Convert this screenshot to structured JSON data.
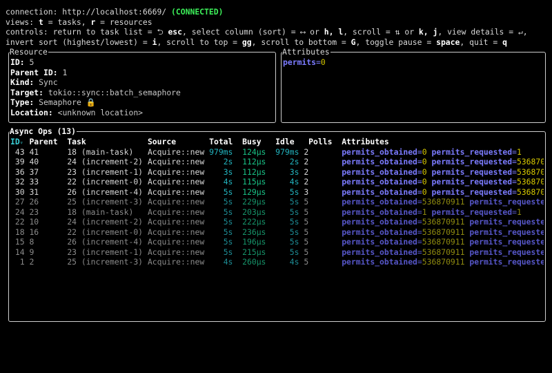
{
  "header": {
    "connection_label": "connection: http://localhost:6669/ ",
    "connection_status": "(CONNECTED)",
    "views": [
      {
        "text": "views: "
      },
      {
        "key": "t"
      },
      {
        "text": " = tasks, "
      },
      {
        "key": "r"
      },
      {
        "text": " = resources"
      }
    ],
    "controls1": [
      {
        "text": "controls: return to task list = ⮌ "
      },
      {
        "key": "esc"
      },
      {
        "text": ", select column (sort) = ⟷ or "
      },
      {
        "key": "h, l"
      },
      {
        "text": ", scroll = ⇅ or "
      },
      {
        "key": "k, j"
      },
      {
        "text": ", view details = ↵,"
      }
    ],
    "controls2": [
      {
        "text": "invert sort (highest/lowest) = "
      },
      {
        "key": "i"
      },
      {
        "text": ", scroll to top = "
      },
      {
        "key": "gg"
      },
      {
        "text": ", scroll to bottom = "
      },
      {
        "key": "G"
      },
      {
        "text": ", toggle pause = "
      },
      {
        "key": "space"
      },
      {
        "text": ", quit = "
      },
      {
        "key": "q"
      }
    ]
  },
  "resource": {
    "title": "Resource",
    "fields": [
      {
        "label": "ID:",
        "value": "5"
      },
      {
        "label": "Parent ID:",
        "value": "1"
      },
      {
        "label": "Kind:",
        "value": "Sync"
      },
      {
        "label": "Target:",
        "value": "tokio::sync::batch_semaphore"
      },
      {
        "label": "Type:",
        "value": "Semaphore 🔒"
      },
      {
        "label": "Location:",
        "value": "<unknown location>"
      }
    ]
  },
  "attributes": {
    "title": "Attributes",
    "items": [
      {
        "key": "permits",
        "value": "0"
      }
    ]
  },
  "async_ops": {
    "title": "Async Ops (13)",
    "sort_column": "ID",
    "sort_icon": "▿",
    "columns": [
      "ID",
      "Parent",
      "Task",
      "Source",
      "Total",
      "Busy",
      "Idle",
      "Polls",
      "Attributes"
    ],
    "rows": [
      {
        "id": "43",
        "parent": "41",
        "task": "18 (main-task)",
        "source": "Acquire::new",
        "total": "979ms",
        "busy": "124µs",
        "idle": "979ms",
        "polls": "2",
        "dim": false,
        "attrs": [
          {
            "key": "permits_obtained",
            "value": "0"
          },
          {
            "key": "permits_requested",
            "value": "1"
          }
        ]
      },
      {
        "id": "39",
        "parent": "40",
        "task": "24 (increment-2)",
        "source": "Acquire::new",
        "total": "2s",
        "busy": "112µs",
        "idle": "2s",
        "polls": "2",
        "dim": false,
        "attrs": [
          {
            "key": "permits_obtained",
            "value": "0"
          },
          {
            "key": "permits_requested",
            "value": "536870"
          }
        ]
      },
      {
        "id": "36",
        "parent": "37",
        "task": "23 (increment-1)",
        "source": "Acquire::new",
        "total": "3s",
        "busy": "112µs",
        "idle": "3s",
        "polls": "2",
        "dim": false,
        "attrs": [
          {
            "key": "permits_obtained",
            "value": "0"
          },
          {
            "key": "permits_requested",
            "value": "536870"
          }
        ]
      },
      {
        "id": "32",
        "parent": "33",
        "task": "22 (increment-0)",
        "source": "Acquire::new",
        "total": "4s",
        "busy": "115µs",
        "idle": "4s",
        "polls": "2",
        "dim": false,
        "attrs": [
          {
            "key": "permits_obtained",
            "value": "0"
          },
          {
            "key": "permits_requested",
            "value": "536870"
          }
        ]
      },
      {
        "id": "30",
        "parent": "31",
        "task": "26 (increment-4)",
        "source": "Acquire::new",
        "total": "5s",
        "busy": "129µs",
        "idle": "5s",
        "polls": "3",
        "dim": false,
        "attrs": [
          {
            "key": "permits_obtained",
            "value": "0"
          },
          {
            "key": "permits_requested",
            "value": "536870"
          }
        ]
      },
      {
        "id": "27",
        "parent": "26",
        "task": "25 (increment-3)",
        "source": "Acquire::new",
        "total": "5s",
        "busy": "229µs",
        "idle": "5s",
        "polls": "5",
        "dim": true,
        "attrs": [
          {
            "key": "permits_obtained",
            "value": "536870911"
          },
          {
            "key": "permits_requeste",
            "value": ""
          }
        ]
      },
      {
        "id": "24",
        "parent": "23",
        "task": "18 (main-task)",
        "source": "Acquire::new",
        "total": "5s",
        "busy": "203µs",
        "idle": "5s",
        "polls": "5",
        "dim": true,
        "attrs": [
          {
            "key": "permits_obtained",
            "value": "1"
          },
          {
            "key": "permits_requested",
            "value": "1"
          }
        ]
      },
      {
        "id": "22",
        "parent": "10",
        "task": "24 (increment-2)",
        "source": "Acquire::new",
        "total": "5s",
        "busy": "222µs",
        "idle": "5s",
        "polls": "5",
        "dim": true,
        "attrs": [
          {
            "key": "permits_obtained",
            "value": "536870911"
          },
          {
            "key": "permits_requeste",
            "value": ""
          }
        ]
      },
      {
        "id": "18",
        "parent": "16",
        "task": "22 (increment-0)",
        "source": "Acquire::new",
        "total": "5s",
        "busy": "236µs",
        "idle": "5s",
        "polls": "5",
        "dim": true,
        "attrs": [
          {
            "key": "permits_obtained",
            "value": "536870911"
          },
          {
            "key": "permits_requeste",
            "value": ""
          }
        ]
      },
      {
        "id": "15",
        "parent": "8",
        "task": "26 (increment-4)",
        "source": "Acquire::new",
        "total": "5s",
        "busy": "196µs",
        "idle": "5s",
        "polls": "5",
        "dim": true,
        "attrs": [
          {
            "key": "permits_obtained",
            "value": "536870911"
          },
          {
            "key": "permits_requeste",
            "value": ""
          }
        ]
      },
      {
        "id": "14",
        "parent": "9",
        "task": "23 (increment-1)",
        "source": "Acquire::new",
        "total": "5s",
        "busy": "215µs",
        "idle": "5s",
        "polls": "5",
        "dim": true,
        "attrs": [
          {
            "key": "permits_obtained",
            "value": "536870911"
          },
          {
            "key": "permits_requeste",
            "value": ""
          }
        ]
      },
      {
        "id": "1",
        "parent": "2",
        "task": "25 (increment-3)",
        "source": "Acquire::new",
        "total": "4s",
        "busy": "260µs",
        "idle": "4s",
        "polls": "5",
        "dim": true,
        "attrs": [
          {
            "key": "permits_obtained",
            "value": "536870911"
          },
          {
            "key": "permits_requeste",
            "value": ""
          }
        ]
      }
    ]
  },
  "colors": {
    "connected": "#3df05a",
    "attr_key": "#7b7bff",
    "attr_value": "#d6c800",
    "total": "#22b5c0",
    "busy": "#19c488",
    "sort_header": "#3ad0d8"
  }
}
